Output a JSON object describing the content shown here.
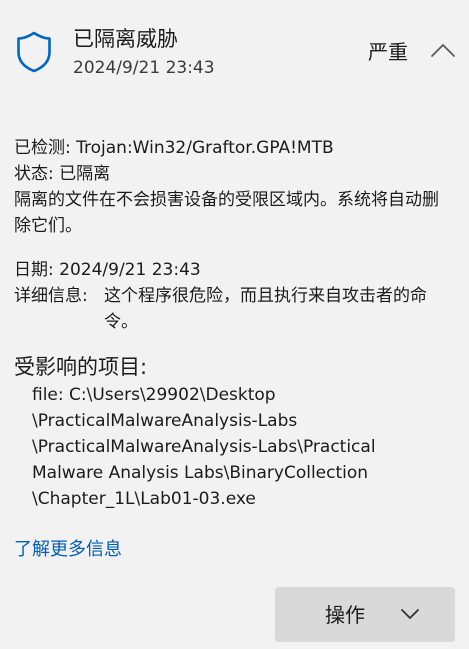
{
  "header": {
    "title": "已隔离威胁",
    "timestamp": "2024/9/21 23:43",
    "severity": "严重",
    "shield_icon": "shield-icon",
    "collapse_icon": "chevron-up-icon"
  },
  "details": {
    "detected_label": "已检测:",
    "detected_value": "Trojan:Win32/Graftor.GPA!MTB",
    "status_label": "状态:",
    "status_value": "已隔离",
    "description": "隔离的文件在不会损害设备的受限区域内。系统将自动删除它们。",
    "date_label": "日期:",
    "date_value": "2024/9/21 23:43",
    "details_label": "详细信息:",
    "details_value": "这个程序很危险，而且执行来自攻击者的命令。"
  },
  "affected": {
    "title": "受影响的项目:",
    "path_lines": [
      "file: C:\\Users\\29902\\Desktop",
      "\\PracticalMalwareAnalysis-Labs",
      "\\PracticalMalwareAnalysis-Labs\\Practical",
      "Malware Analysis Labs\\BinaryCollection",
      "\\Chapter_1L\\Lab01-03.exe"
    ]
  },
  "links": {
    "more_info": "了解更多信息"
  },
  "actions": {
    "button_label": "操作",
    "chevron_icon": "chevron-down-icon"
  },
  "colors": {
    "background": "#f2f2f2",
    "accent": "#005fb8",
    "button": "#d9d9d9"
  }
}
